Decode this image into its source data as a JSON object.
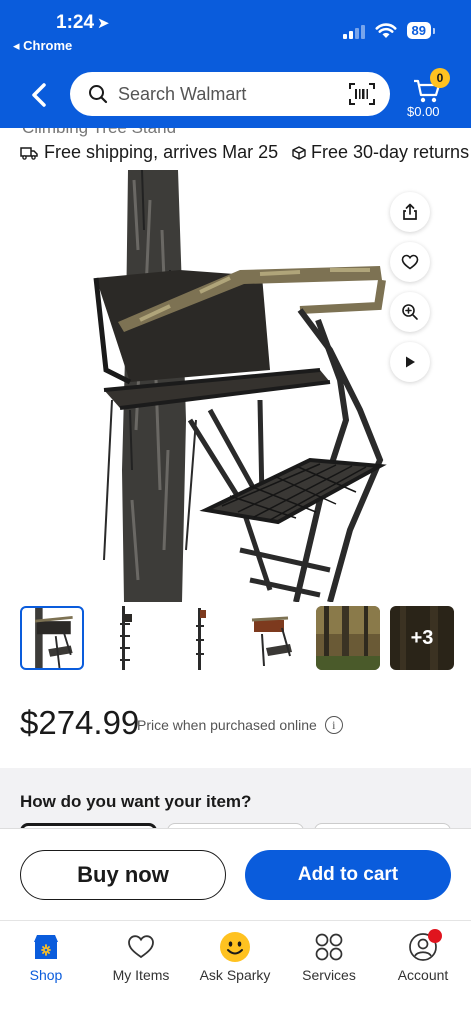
{
  "status_bar": {
    "time": "1:24",
    "back_app": "Chrome",
    "battery": "89"
  },
  "header": {
    "search_placeholder": "Search Walmart",
    "cart_count": "0",
    "cart_total": "$0.00"
  },
  "shipping": {
    "cut_text": "Climbing Tree Stand",
    "free_shipping": "Free shipping, arrives Mar 25",
    "free_returns": "Free 30-day returns"
  },
  "product": {
    "more_images": "+3",
    "price": "$274.99",
    "price_note": "Price when purchased online"
  },
  "fulfillment": {
    "heading": "How do you want your item?"
  },
  "actions": {
    "buy_now": "Buy now",
    "add_to_cart": "Add to cart"
  },
  "tabs": [
    {
      "label": "Shop",
      "icon": "shop-icon"
    },
    {
      "label": "My Items",
      "icon": "heart-icon"
    },
    {
      "label": "Ask Sparky",
      "icon": "sparky-icon"
    },
    {
      "label": "Services",
      "icon": "services-icon"
    },
    {
      "label": "Account",
      "icon": "account-icon"
    }
  ],
  "colors": {
    "brand_blue": "#0a5cdc",
    "spark_yellow": "#ffc220",
    "notification_red": "#e0141e"
  }
}
